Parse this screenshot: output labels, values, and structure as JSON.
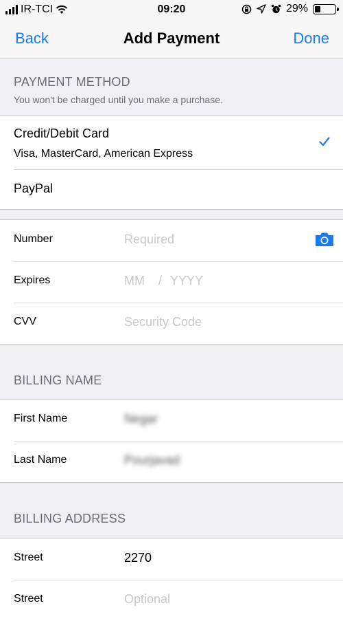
{
  "status_bar": {
    "carrier": "IR-TCI",
    "time": "09:20",
    "battery": "29%",
    "battery_level": 0.29,
    "icons": [
      "signal-icon",
      "wifi-icon",
      "rotation-lock-icon",
      "location-icon",
      "alarm-icon",
      "battery-icon"
    ]
  },
  "nav": {
    "back": "Back",
    "title": "Add Payment",
    "done": "Done"
  },
  "payment_method": {
    "header": "PAYMENT METHOD",
    "subheader": "You won't be charged until you make a purchase.",
    "options": [
      {
        "title": "Credit/Debit Card",
        "subtitle": "Visa, MasterCard, American Express",
        "selected": true
      },
      {
        "title": "PayPal",
        "selected": false
      }
    ]
  },
  "card": {
    "number_label": "Number",
    "number_placeholder": "Required",
    "expires_label": "Expires",
    "expires_month_placeholder": "MM",
    "expires_separator": "/",
    "expires_year_placeholder": "YYYY",
    "cvv_label": "CVV",
    "cvv_placeholder": "Security Code"
  },
  "billing_name": {
    "header": "BILLING NAME",
    "first_name_label": "First Name",
    "first_name_value": "Negar",
    "last_name_label": "Last Name",
    "last_name_value": "Pourjavad"
  },
  "billing_address": {
    "header": "BILLING ADDRESS",
    "street1_label": "Street",
    "street1_value": "2270",
    "street2_label": "Street",
    "street2_placeholder": "Optional"
  },
  "colors": {
    "accent": "#1a7bef",
    "background": "#efeff4",
    "placeholder": "#c7c7cd",
    "section_text": "#6d6d72"
  }
}
